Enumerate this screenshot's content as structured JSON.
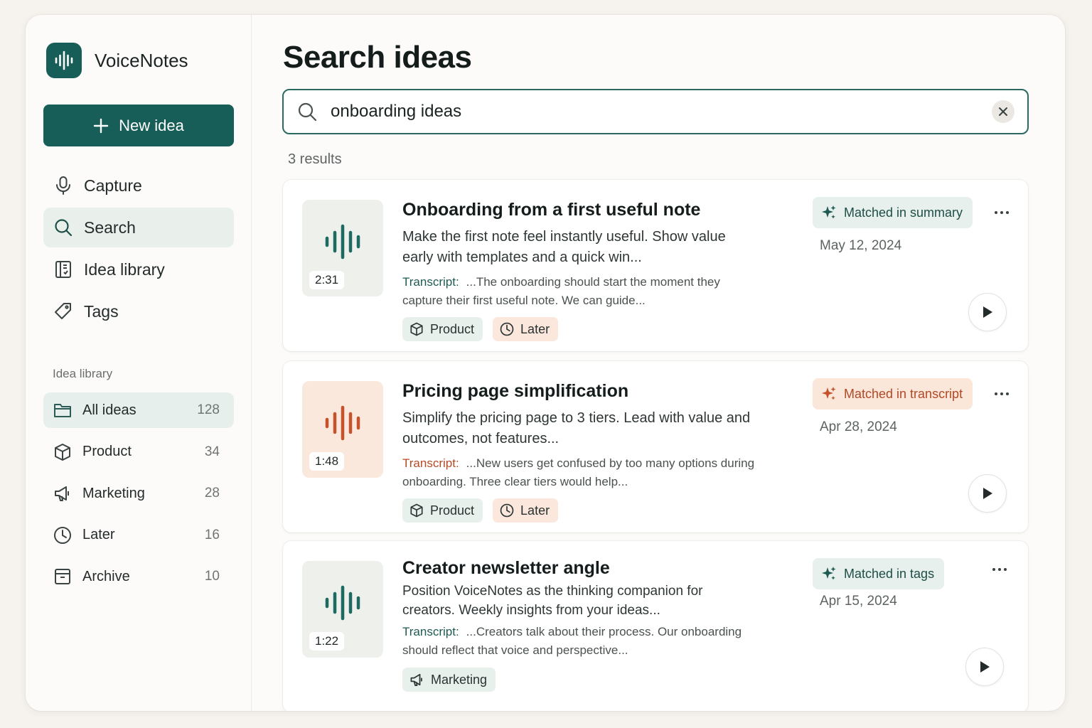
{
  "app": {
    "name": "VoiceNotes"
  },
  "sidebar": {
    "new_button": "New idea",
    "nav": [
      {
        "label": "Capture",
        "icon": "microphone-icon"
      },
      {
        "label": "Search",
        "icon": "search-icon",
        "active": true
      },
      {
        "label": "Idea library",
        "icon": "book-icon"
      },
      {
        "label": "Tags",
        "icon": "tag-icon"
      }
    ],
    "library_heading": "Idea library",
    "library": [
      {
        "label": "All ideas",
        "count": "128",
        "icon": "folder-icon",
        "active": true
      },
      {
        "label": "Product",
        "count": "34",
        "icon": "cube-icon"
      },
      {
        "label": "Marketing",
        "count": "28",
        "icon": "megaphone-icon"
      },
      {
        "label": "Later",
        "count": "16",
        "icon": "clock-icon"
      },
      {
        "label": "Archive",
        "count": "10",
        "icon": "archive-icon"
      }
    ]
  },
  "main": {
    "title": "Search ideas",
    "search": {
      "value": "onboarding ideas"
    },
    "results_count": "3 results",
    "results": [
      {
        "title": "Onboarding from a first useful note",
        "summary": "Make the first note feel instantly useful. Show value early with templates and a quick win...",
        "transcript_label": "Transcript:",
        "transcript": "...The onboarding should start the moment they capture their first useful note. We can guide...",
        "duration": "2:31",
        "match": "Matched in summary",
        "date": "May 12, 2024",
        "tags": [
          {
            "label": "Product",
            "icon": "cube-icon"
          },
          {
            "label": "Later",
            "icon": "clock-icon"
          }
        ]
      },
      {
        "title": "Pricing page simplification",
        "summary": "Simplify the pricing page to 3 tiers. Lead with value and outcomes, not features...",
        "transcript_label": "Transcript:",
        "transcript": "...New users get confused by too many options during onboarding. Three clear tiers would help...",
        "duration": "1:48",
        "match": "Matched in transcript",
        "date": "Apr 28, 2024",
        "tags": [
          {
            "label": "Product",
            "icon": "cube-icon"
          },
          {
            "label": "Later",
            "icon": "clock-icon"
          }
        ]
      },
      {
        "title": "Creator newsletter angle",
        "summary": "Position VoiceNotes as the thinking companion for creators. Weekly insights from your ideas...",
        "transcript_label": "Transcript:",
        "transcript": "...Creators talk about their process. Our onboarding should reflect that voice and perspective...",
        "duration": "1:22",
        "match": "Matched in tags",
        "date": "Apr 15, 2024",
        "tags": [
          {
            "label": "Marketing",
            "icon": "megaphone-icon"
          }
        ]
      }
    ]
  },
  "colors": {
    "accent": "#165e57",
    "orange_accent": "#b54a26",
    "orange_bg": "#fbe7dc",
    "green_bg": "#e8f0ec"
  }
}
